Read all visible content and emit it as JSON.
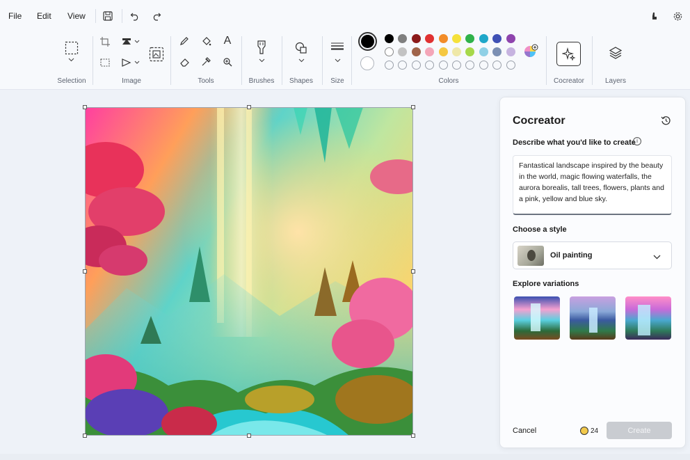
{
  "menu": {
    "file": "File",
    "edit": "Edit",
    "view": "View"
  },
  "toolbar": {
    "save_icon": "save-icon",
    "undo_icon": "undo-icon",
    "redo_icon": "redo-icon"
  },
  "ribbon": {
    "groups": {
      "selection": "Selection",
      "image": "Image",
      "tools": "Tools",
      "brushes": "Brushes",
      "shapes": "Shapes",
      "size": "Size",
      "colors": "Colors",
      "cocreator": "Cocreator",
      "layers": "Layers"
    },
    "text_tool_glyph": "A",
    "colors_row1": [
      "#000000",
      "#7f7f7f",
      "#8b1a1a",
      "#e03131",
      "#f28c28",
      "#f5e13a",
      "#2fb24a",
      "#1fa7c9",
      "#3f51b5",
      "#8e44ad"
    ],
    "colors_row2": [
      "#ffffff",
      "#c3c3c3",
      "#a0644a",
      "#f4a6b8",
      "#f5c842",
      "#efe8a8",
      "#a6d84a",
      "#8fd0e6",
      "#7b8fb3",
      "#c6b3e0"
    ],
    "primary_color": "#000000",
    "secondary_color": "#ffffff"
  },
  "cocreator": {
    "title": "Cocreator",
    "describe_label": "Describe what you'd like to create",
    "prompt": "Fantastical landscape inspired by the beauty in the world, magic flowing waterfalls, the aurora borealis, tall trees, flowers, plants and a pink, yellow and blue sky.",
    "style_label": "Choose a style",
    "style_value": "Oil painting",
    "variations_label": "Explore variations",
    "cancel": "Cancel",
    "credits": "24",
    "create": "Create"
  }
}
